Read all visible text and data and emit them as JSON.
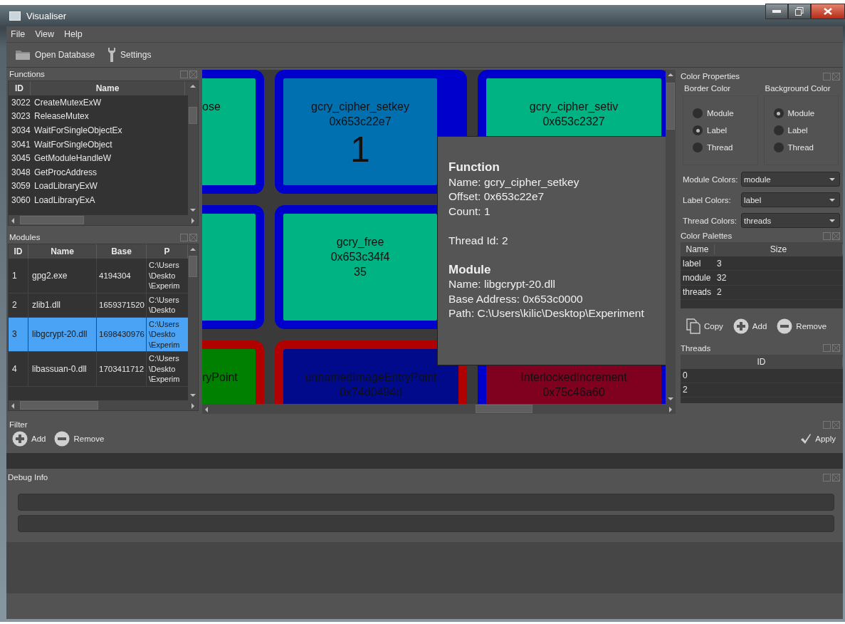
{
  "window": {
    "title": "Visualiser"
  },
  "menu": [
    "File",
    "View",
    "Help"
  ],
  "toolbar": [
    {
      "kind": "folder",
      "label": "Open Database"
    },
    {
      "kind": "wrench",
      "label": "Settings"
    }
  ],
  "functions": {
    "title": "Functions",
    "columns": [
      "ID",
      "Name"
    ],
    "rows": [
      {
        "id": "3022",
        "name": "CreateMutexExW"
      },
      {
        "id": "3023",
        "name": "ReleaseMutex"
      },
      {
        "id": "3034",
        "name": "WaitForSingleObjectEx"
      },
      {
        "id": "3041",
        "name": "WaitForSingleObject"
      },
      {
        "id": "3045",
        "name": "GetModuleHandleW"
      },
      {
        "id": "3048",
        "name": "GetProcAddress"
      },
      {
        "id": "3059",
        "name": "LoadLibraryExW"
      },
      {
        "id": "3060",
        "name": "LoadLibraryExA"
      }
    ]
  },
  "modules": {
    "title": "Modules",
    "columns": [
      "ID",
      "Name",
      "Base",
      "P"
    ],
    "rows": [
      {
        "id": "1",
        "name": "gpg2.exe",
        "base": "4194304",
        "path": [
          "C:\\Users",
          "\\Deskto",
          "\\Experim"
        ],
        "selected": false
      },
      {
        "id": "2",
        "name": "zlib1.dll",
        "base": "1659371520",
        "path": [
          "C:\\Users",
          "\\Deskto"
        ],
        "selected": false
      },
      {
        "id": "3",
        "name": "libgcrypt-20.dll",
        "base": "1698430976",
        "path": [
          "C:\\Users",
          "\\Deskto",
          "\\Experim"
        ],
        "selected": true
      },
      {
        "id": "4",
        "name": "libassuan-0.dll",
        "base": "1703411712",
        "path": [
          "C:\\Users",
          "\\Deskto",
          "\\Experim"
        ],
        "selected": false
      }
    ]
  },
  "canvas": {
    "rows": [
      [
        {
          "name": "ose",
          "border": {
            "color": "#0000cc"
          },
          "color": "#00b383",
          "selected": false
        },
        {
          "name": "gcry_cipher_setkey",
          "address": "0x653c22e7",
          "count": "1",
          "border": {
            "color": "#0000cc"
          },
          "selected": true
        },
        {
          "name": "gcry_cipher_setiv",
          "address": "0x653c2327",
          "border": {
            "color": "#0000cc"
          },
          "color": "#00b383",
          "selected": false
        }
      ],
      [
        {
          "border": {
            "color": "#0000cc"
          },
          "color": "#00b383",
          "selected": false
        },
        {
          "name": "gcry_free",
          "address": "0x653c34f4",
          "count": "35",
          "border": {
            "color": "#0000cc"
          },
          "color": "#00b383",
          "selected": false
        }
      ],
      [
        {
          "name": "ryPoint",
          "border": {
            "color": "#b00000"
          },
          "color": "#008000",
          "selected": false
        },
        {
          "name": "unnamedImageEntryPoint",
          "address": "0x74d0494d",
          "border": {
            "color": "#b00000"
          },
          "color": "#000a8a",
          "selected": false
        },
        {
          "name": "InterlockedIncrement",
          "address": "0x75c46a60",
          "border": {
            "color": "#0000cc"
          },
          "color": "#800020",
          "selected": false
        }
      ]
    ],
    "tooltip": [
      {
        "kind": "heading",
        "text": "Function"
      },
      {
        "kind": "line",
        "text": "Name: gcry_cipher_setkey"
      },
      {
        "kind": "line",
        "text": "Offset: 0x653c22e7"
      },
      {
        "kind": "line",
        "text": "Count: 1"
      },
      {
        "kind": "gap"
      },
      {
        "kind": "line",
        "text": "Thread Id: 2"
      },
      {
        "kind": "gap"
      },
      {
        "kind": "heading",
        "text": "Module"
      },
      {
        "kind": "line",
        "text": "Name: libgcrypt-20.dll"
      },
      {
        "kind": "line",
        "text": "Base Address: 0x653c0000"
      },
      {
        "kind": "line",
        "text": "Path: C:\\Users\\kilic\\Desktop\\Experiment"
      }
    ]
  },
  "color_properties": {
    "title": "Color Properties",
    "groups": [
      {
        "title": "Border Color",
        "options": [
          {
            "label": "Module",
            "selected": false
          },
          {
            "label": "Label",
            "selected": true
          },
          {
            "label": "Thread",
            "selected": false
          }
        ]
      },
      {
        "title": "Background Color",
        "options": [
          {
            "label": "Module",
            "selected": true
          },
          {
            "label": "Label",
            "selected": false
          },
          {
            "label": "Thread",
            "selected": false
          }
        ]
      }
    ],
    "combos": [
      {
        "label": "Module Colors:",
        "value": "module"
      },
      {
        "label": "Label Colors:",
        "value": "label"
      },
      {
        "label": "Thread Colors:",
        "value": "threads"
      }
    ]
  },
  "color_palettes": {
    "title": "Color Palettes",
    "columns": [
      "Name",
      "Size"
    ],
    "rows": [
      {
        "name": "label",
        "size": "3"
      },
      {
        "name": "module",
        "size": "32"
      },
      {
        "name": "threads",
        "size": "2"
      }
    ],
    "buttons": [
      {
        "kind": "copy",
        "label": "Copy"
      },
      {
        "kind": "add",
        "label": "Add"
      },
      {
        "kind": "remove",
        "label": "Remove"
      }
    ]
  },
  "threads": {
    "title": "Threads",
    "columns": [
      "ID"
    ],
    "rows": [
      "0",
      "2"
    ]
  },
  "filter": {
    "title": "Filter",
    "actions": [
      {
        "kind": "add",
        "label": "Add"
      },
      {
        "kind": "remove",
        "label": "Remove"
      }
    ],
    "apply": {
      "kind": "check",
      "label": "Apply"
    }
  },
  "debug": {
    "title": "Debug Info"
  }
}
